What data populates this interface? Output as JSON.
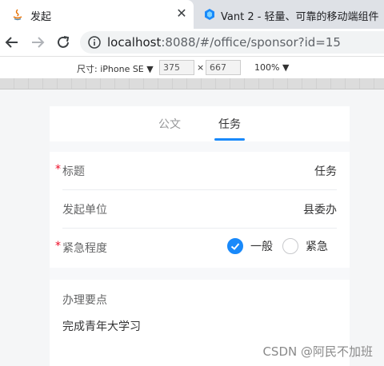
{
  "browser": {
    "active_tab_title": "发起",
    "inactive_tab_title": "Vant 2 - 轻量、可靠的移动端组件",
    "url_host": "localhost",
    "url_rest": ":8088/#/office/sponsor?id=15"
  },
  "device_toolbar": {
    "device_label": "尺寸: iPhone SE",
    "width": "375",
    "times": "×",
    "height": "667",
    "zoom": "100%"
  },
  "app": {
    "tabs": [
      {
        "label": "公文",
        "active": false
      },
      {
        "label": "任务",
        "active": true
      }
    ],
    "form": {
      "title_label": "标题",
      "title_value": "任务",
      "unit_label": "发起单位",
      "unit_value": "县委办",
      "urgency_label": "紧急程度",
      "urgency_options": [
        "一般",
        "紧急"
      ],
      "urgency_selected": "一般",
      "required_mark": "*"
    },
    "points": {
      "label": "办理要点",
      "value": "完成青年大学习"
    }
  },
  "watermark": "CSDN @阿民不加班",
  "colors": {
    "accent": "#1989fa",
    "required": "#ee0a24"
  }
}
